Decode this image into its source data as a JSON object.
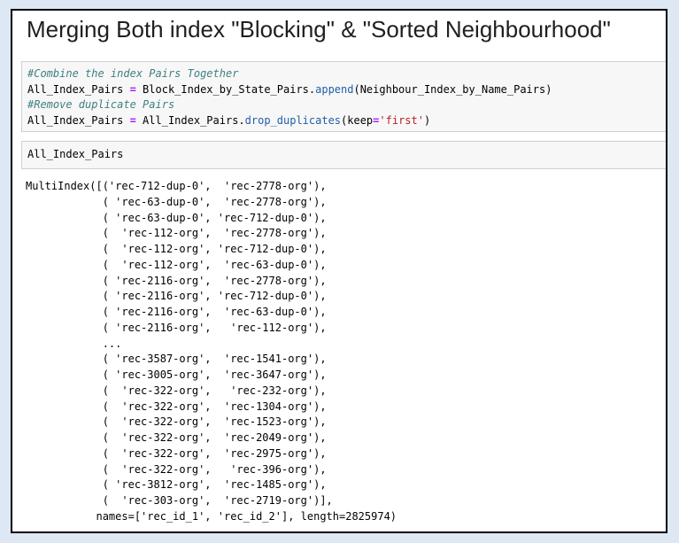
{
  "heading": "Merging Both index \"Blocking\" & \"Sorted Neighbourhood\"",
  "cell1": {
    "comment1": "#Combine the index Pairs Together",
    "line2": {
      "var": "All_Index_Pairs ",
      "op": "=",
      "obj": " Block_Index_by_State_Pairs.",
      "method": "append",
      "args": "(Neighbour_Index_by_Name_Pairs)"
    },
    "comment2": "#Remove duplicate Pairs",
    "line4": {
      "var": "All_Index_Pairs ",
      "op": "=",
      "obj": " All_Index_Pairs.",
      "method": "drop_duplicates",
      "args_open": "(keep",
      "eq": "=",
      "str": "'first'",
      "args_close": ")"
    }
  },
  "cell2": {
    "code": "All_Index_Pairs"
  },
  "output": {
    "lines": [
      "MultiIndex([('rec-712-dup-0',  'rec-2778-org'),",
      "            ( 'rec-63-dup-0',  'rec-2778-org'),",
      "            ( 'rec-63-dup-0', 'rec-712-dup-0'),",
      "            (  'rec-112-org',  'rec-2778-org'),",
      "            (  'rec-112-org', 'rec-712-dup-0'),",
      "            (  'rec-112-org',  'rec-63-dup-0'),",
      "            ( 'rec-2116-org',  'rec-2778-org'),",
      "            ( 'rec-2116-org', 'rec-712-dup-0'),",
      "            ( 'rec-2116-org',  'rec-63-dup-0'),",
      "            ( 'rec-2116-org',   'rec-112-org'),",
      "            ...",
      "            ( 'rec-3587-org',  'rec-1541-org'),",
      "            ( 'rec-3005-org',  'rec-3647-org'),",
      "            (  'rec-322-org',   'rec-232-org'),",
      "            (  'rec-322-org',  'rec-1304-org'),",
      "            (  'rec-322-org',  'rec-1523-org'),",
      "            (  'rec-322-org',  'rec-2049-org'),",
      "            (  'rec-322-org',  'rec-2975-org'),",
      "            (  'rec-322-org',   'rec-396-org'),",
      "            ( 'rec-3812-org',  'rec-1485-org'),",
      "            (  'rec-303-org',  'rec-2719-org')],",
      "           names=['rec_id_1', 'rec_id_2'], length=2825974)"
    ]
  }
}
